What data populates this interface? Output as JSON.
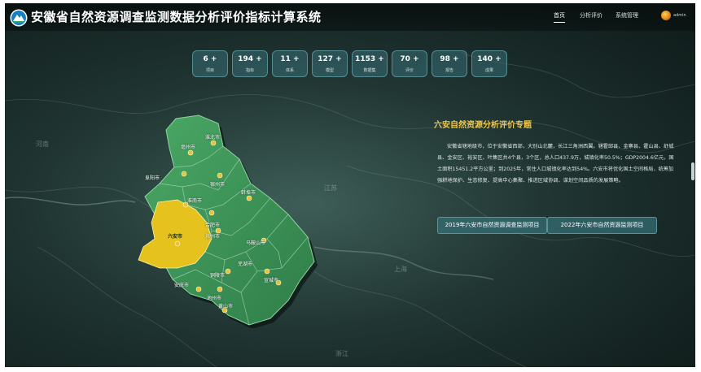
{
  "header": {
    "title": "安徽省自然资源调查监测数据分析评价指标计算系统",
    "nav": [
      {
        "label": "首页",
        "active": true
      },
      {
        "label": "分析评价",
        "active": false
      },
      {
        "label": "系统管理",
        "active": false
      }
    ],
    "user": "admin"
  },
  "stats": [
    {
      "value": "6 +",
      "label": "项目"
    },
    {
      "value": "194 +",
      "label": "指标"
    },
    {
      "value": "11 +",
      "label": "体系"
    },
    {
      "value": "127 +",
      "label": "模型"
    },
    {
      "value": "1153 +",
      "label": "数据集"
    },
    {
      "value": "70 +",
      "label": "评价"
    },
    {
      "value": "98 +",
      "label": "报告"
    },
    {
      "value": "140 +",
      "label": "成果"
    }
  ],
  "regions": {
    "henan": "河南",
    "jiangsu": "江苏",
    "shanghai": "上海",
    "zhejiang": "浙江"
  },
  "cities": {
    "huaibei": "淮北市",
    "bozhou": "亳州市",
    "suzhou": "宿州市",
    "fuyang": "阜阳市",
    "bengbu": "蚌埠市",
    "huainan": "淮南市",
    "chuzhou": "滁州市",
    "luan": "六安市",
    "hefei": "合肥市",
    "maanshan": "马鞍山市",
    "wuhu": "芜湖市",
    "xuancheng": "宣城市",
    "tongling": "铜陵市",
    "anqing": "安庆市",
    "chizhou": "池州市",
    "huangshan": "黄山市"
  },
  "panel": {
    "title": "六安自然资源分析评价专题",
    "description": "安徽省辖地级市，位于安徽省西部，大别山北麓，长江三角洲西翼。辖霍邱县、金寨县、霍山县、舒城县、金安区、裕安区、叶集区共4个县，3个区，总人口437.9万，城镇化率50.5%；GDP2004.6亿元，国土面积15451.2平方公里；到2025年，常住人口城镇化率达到54%。六安市将优化国土空间格局，统筹加强耕地保护、生态修复、提高中心集聚、推进区域协调、谋划空间品质的发展策略。",
    "buttons": [
      {
        "label": "2019年六安市自然资源调查监测项目"
      },
      {
        "label": "2022年六安市自然资源监测项目"
      }
    ]
  },
  "colors": {
    "highlight": "#f1c74a",
    "province": "#3f9a58",
    "selected": "#e5c21e"
  }
}
